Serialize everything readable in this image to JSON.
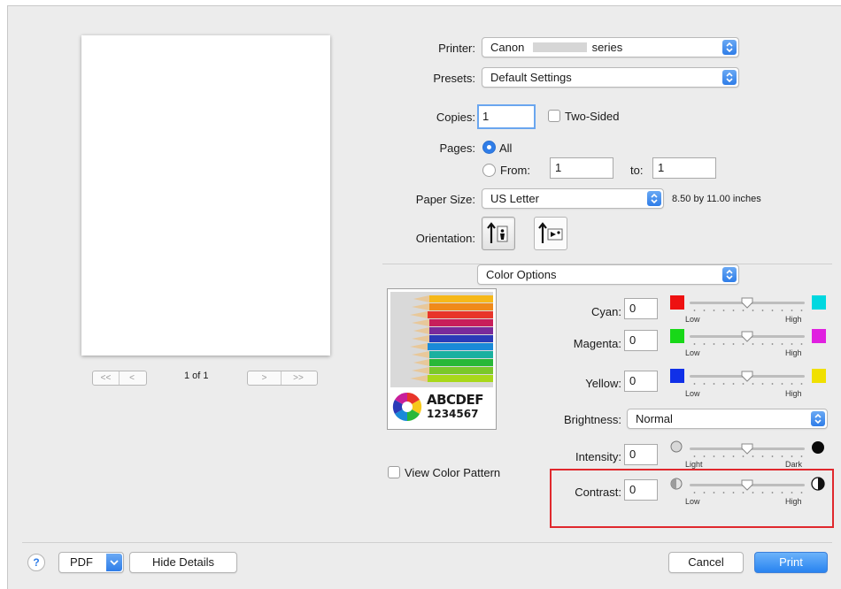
{
  "printer": {
    "label": "Printer:",
    "value_prefix": "Canon",
    "value_suffix": "series"
  },
  "presets": {
    "label": "Presets:",
    "value": "Default Settings"
  },
  "copies": {
    "label": "Copies:",
    "value": "1",
    "two_sided_label": "Two-Sided"
  },
  "pages": {
    "label": "Pages:",
    "all_label": "All",
    "from_label": "From:",
    "from_value": "1",
    "to_label": "to:",
    "to_value": "1"
  },
  "paper_size": {
    "label": "Paper Size:",
    "value": "US Letter",
    "dimensions": "8.50 by 11.00 inches"
  },
  "orientation": {
    "label": "Orientation:"
  },
  "panel_select": {
    "value": "Color Options"
  },
  "preview": {
    "page_counter": "1 of 1",
    "first": "<<",
    "prev": "<",
    "next": ">",
    "last": ">>"
  },
  "color_image": {
    "text_line1": "ABCDEF",
    "text_line2": "1234567"
  },
  "view_color_pattern": "View Color Pattern",
  "cyan": {
    "label": "Cyan:",
    "value": "0",
    "low": "Low",
    "high": "High",
    "position": 0.5
  },
  "magenta": {
    "label": "Magenta:",
    "value": "0",
    "low": "Low",
    "high": "High",
    "position": 0.5
  },
  "yellow": {
    "label": "Yellow:",
    "value": "0",
    "low": "Low",
    "high": "High",
    "position": 0.5
  },
  "brightness": {
    "label": "Brightness:",
    "value": "Normal"
  },
  "intensity": {
    "label": "Intensity:",
    "value": "0",
    "low": "Light",
    "high": "Dark",
    "position": 0.5
  },
  "contrast": {
    "label": "Contrast:",
    "value": "0",
    "low": "Low",
    "high": "High",
    "position": 0.5
  },
  "footer": {
    "help": "?",
    "pdf": "PDF",
    "hide_details": "Hide Details",
    "cancel": "Cancel",
    "print": "Print"
  },
  "colors": {
    "accent": "#2f7de8",
    "highlight_box": "#e0282d",
    "cyan": "#00d8e0",
    "magenta": "#e020e0",
    "yellow": "#f0e000",
    "red": "#ee1111",
    "green": "#18d818",
    "blue": "#1030e8"
  }
}
